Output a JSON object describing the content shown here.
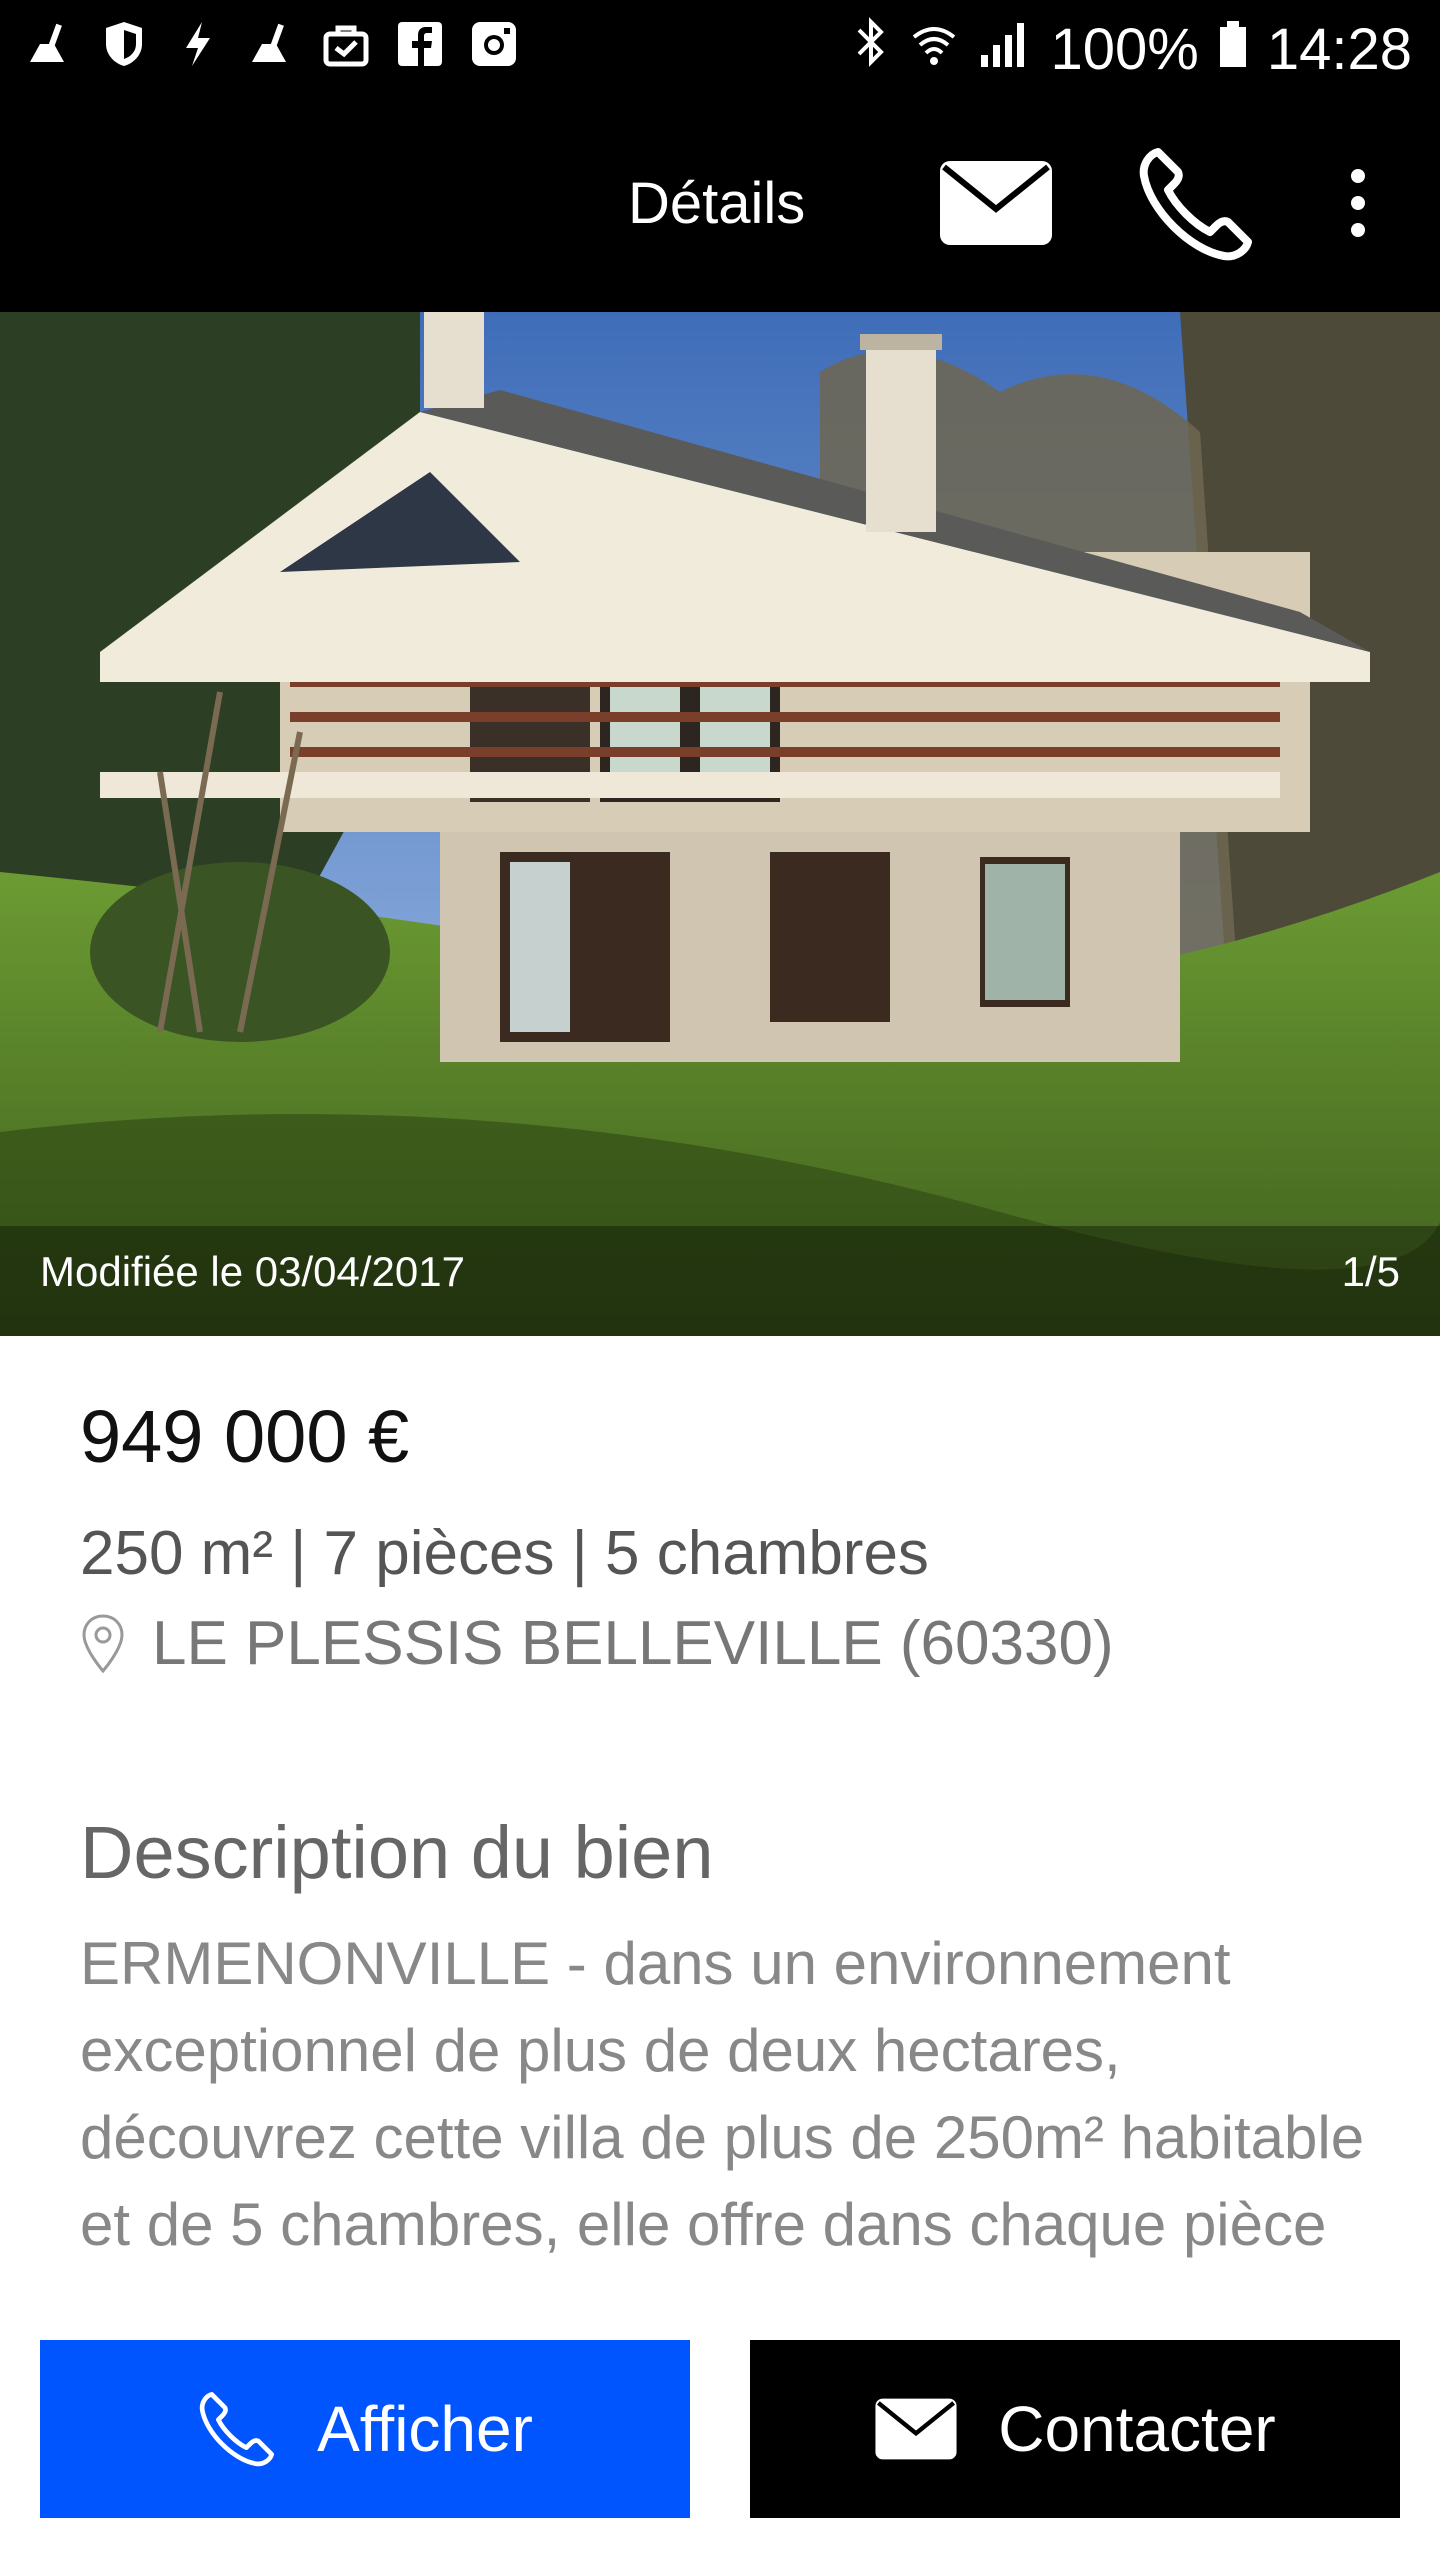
{
  "status_bar": {
    "left_icons": [
      "broom-icon",
      "shield-icon",
      "bolt-icon",
      "broom-icon",
      "bag-icon",
      "facebook-icon",
      "instagram-icon"
    ],
    "right_icons": [
      "bluetooth-icon",
      "wifi-icon",
      "signal-icon",
      "battery-icon"
    ],
    "battery": "100%",
    "time": "14:28"
  },
  "top_bar": {
    "title": "Détails",
    "actions": [
      "mail-icon",
      "phone-icon",
      "more-vert-icon"
    ]
  },
  "listing": {
    "modified_label": "Modifiée le 03/04/2017",
    "photo_counter": "1/5",
    "price": "949 000 €",
    "specs": "250 m² | 7 pièces | 5 chambres",
    "location": "LE PLESSIS BELLEVILLE (60330)",
    "description_title": "Description du bien",
    "description_text": "ERMENONVILLE - dans un environnement exceptionnel de plus de deux hectares, découvrez cette villa de plus de 250m² habitable et de 5 chambres, elle offre dans chaque pièce une vue exceptionnelle sur"
  },
  "actions": {
    "show_label": "Afficher",
    "contact_label": "Contacter"
  },
  "colors": {
    "primary_blue": "#0055FF",
    "black": "#000000"
  }
}
